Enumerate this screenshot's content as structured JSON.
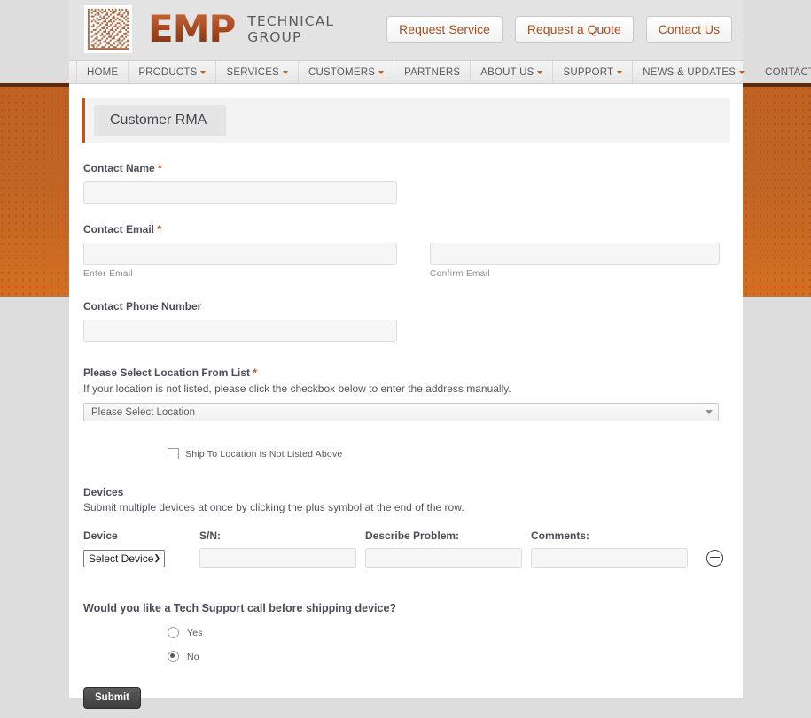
{
  "header": {
    "logo_word": "EMP",
    "logo_line1": "TECHNICAL",
    "logo_line2": "GROUP",
    "datamatrix_alt": "datamatrix-code",
    "buttons": [
      {
        "label": "Request Service"
      },
      {
        "label": "Request a Quote"
      },
      {
        "label": "Contact Us"
      }
    ]
  },
  "nav": {
    "items": [
      {
        "label": "HOME",
        "caret": false
      },
      {
        "label": "PRODUCTS",
        "caret": true
      },
      {
        "label": "SERVICES",
        "caret": true
      },
      {
        "label": "CUSTOMERS",
        "caret": true
      },
      {
        "label": "PARTNERS",
        "caret": false
      },
      {
        "label": "ABOUT US",
        "caret": true
      },
      {
        "label": "SUPPORT",
        "caret": true
      },
      {
        "label": "NEWS & UPDATES",
        "caret": true
      },
      {
        "label": "CONTACT",
        "caret": false
      }
    ]
  },
  "page_title": "Customer RMA",
  "form": {
    "contact_name": {
      "label": "Contact Name",
      "required_mark": "*",
      "value": "",
      "placeholder": ""
    },
    "contact_email": {
      "label": "Contact Email",
      "required_mark": "*",
      "enter_value": "",
      "enter_helper": "Enter Email",
      "confirm_value": "",
      "confirm_helper": "Confirm Email"
    },
    "contact_phone": {
      "label": "Contact Phone Number",
      "value": ""
    },
    "location": {
      "label": "Please Select Location From List",
      "required_mark": "*",
      "note": "If your location is not listed, please click the checkbox below to enter the address manually.",
      "selected": "Please Select Location",
      "caret_icon": "chevron-down-icon"
    },
    "ship_to": {
      "checkbox_label": "Ship To Location is Not Listed Above",
      "checked": false
    },
    "devices": {
      "title": "Devices",
      "note": "Submit multiple devices at once by clicking the plus symbol at the end of the row.",
      "columns": [
        "Device",
        "S/N:",
        "Describe Problem:",
        "Comments:"
      ],
      "row": {
        "device_selected": "Select Device",
        "device_caret": "⌄",
        "serial_number": "",
        "describe_problem": "",
        "comments": ""
      },
      "add_icon": "plus-circle-icon"
    },
    "tech_support": {
      "question": "Would you like a Tech Support call before shipping device?",
      "options": [
        {
          "label": "Yes",
          "selected": false
        },
        {
          "label": "No",
          "selected": true
        }
      ]
    },
    "submit_label": "Submit"
  },
  "colors": {
    "brand_orange": "#c06524",
    "accent_rule": "#b05a22",
    "link_text": "#a4501f",
    "page_bg": "#dddddd"
  }
}
